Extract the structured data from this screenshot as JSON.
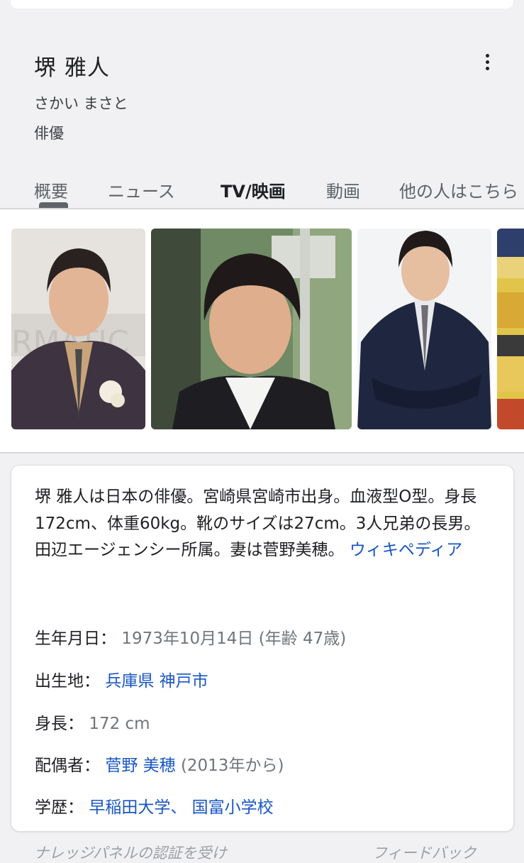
{
  "header": {
    "name": "堺 雅人",
    "reading": "さかい まさと",
    "occupation": "俳優"
  },
  "tabs": [
    {
      "label": "概要",
      "selected": true
    },
    {
      "label": "ニュース",
      "selected": false
    },
    {
      "label": "TV/映画",
      "selected": false
    },
    {
      "label": "動画",
      "selected": false
    },
    {
      "label": "他の人はこちら",
      "selected": false
    }
  ],
  "gallery_icons": [
    "person-photo",
    "person-photo",
    "person-photo",
    "partial-photo"
  ],
  "description": {
    "text": "堺 雅人は日本の俳優。宮崎県宮崎市出身。血液型O型。身長172cm、体重60kg。靴のサイズは27cm。3人兄弟の長男。田辺エージェンシー所属。妻は菅野美穂。",
    "source_link": "ウィキペディア"
  },
  "facts": {
    "birth": {
      "label": "生年月日：",
      "value": "1973年10月14日 (年齢 47歳)"
    },
    "birthplace": {
      "label": "出生地：",
      "link1": "兵庫県",
      "link2": "神戸市"
    },
    "height": {
      "label": "身長：",
      "value": "172 cm"
    },
    "spouse": {
      "label": "配偶者：",
      "link": "菅野 美穂",
      "suffix": "(2013年から)"
    },
    "education": {
      "label": "学歴：",
      "link1": "早稲田大学",
      "separator": "、",
      "link2": "国富小学校"
    }
  },
  "footer": {
    "claim_text": "ナレッジパネルの認証を受け",
    "feedback": "フィードバック"
  },
  "colors": {
    "link": "#1a56c4",
    "background": "#f1f1f3",
    "muted": "#70757a"
  }
}
